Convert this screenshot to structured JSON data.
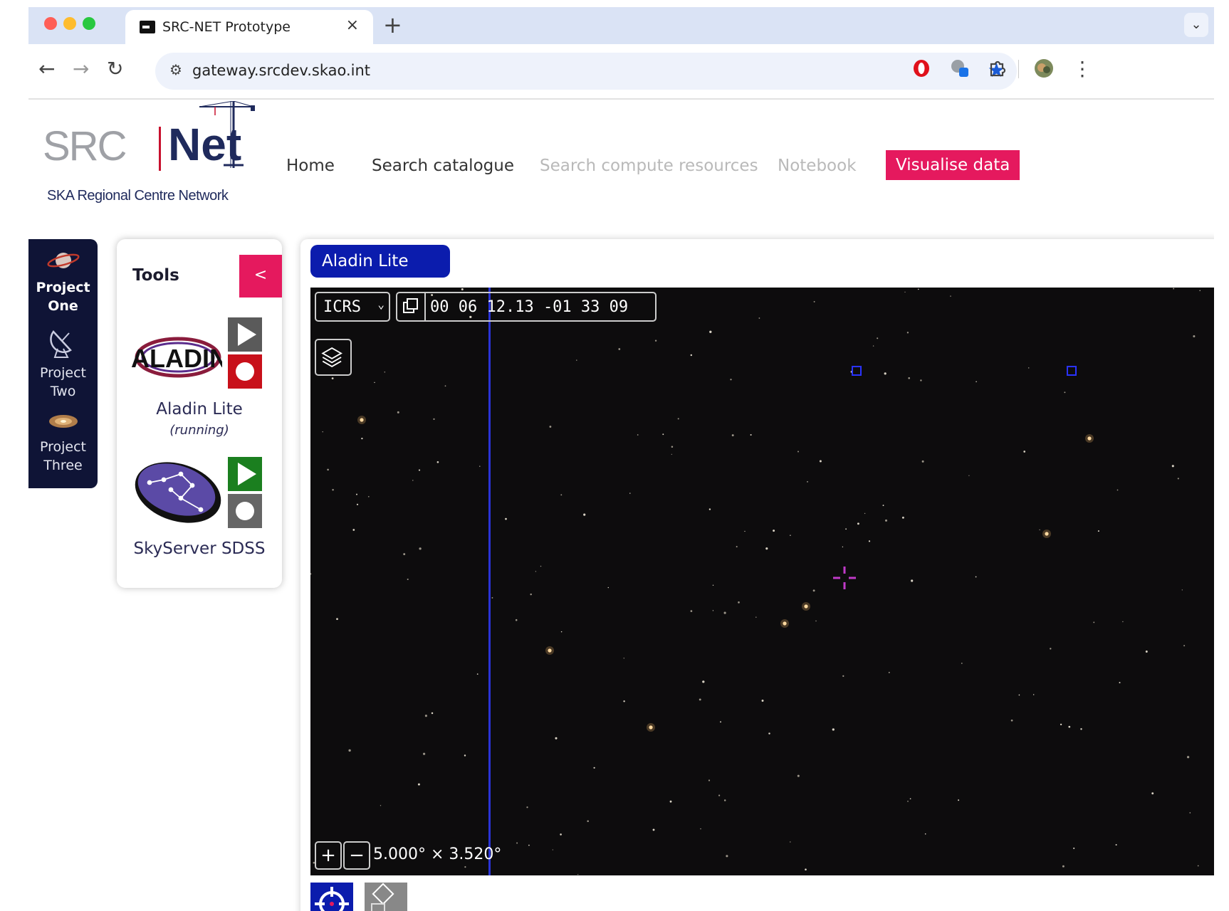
{
  "browser": {
    "tab_title": "SRC-NET Prototype",
    "tab_close": "×",
    "new_tab": "+",
    "tab_dropdown": "⌄",
    "url": "gateway.srcdev.skao.int",
    "back": "←",
    "forward": "→",
    "reload": "↻",
    "bookmark_star": "★",
    "site_settings": "⚙",
    "menu": "⋮",
    "colors": {
      "tabstrip": "#dae3f5",
      "star": "#1a5bd6"
    }
  },
  "site": {
    "logo_src": "SRC",
    "logo_net": "Net",
    "logo_tagline": "SKA Regional Centre Network",
    "nav": {
      "home": "Home",
      "search_catalogue": "Search catalogue",
      "search_compute": "Search compute resources",
      "notebook": "Notebook",
      "visualise": "Visualise data"
    },
    "accent_color": "#e5195e",
    "navy_color": "#0f1436"
  },
  "projects": [
    {
      "line1": "Project",
      "line2": "One",
      "icon": "saturn-icon"
    },
    {
      "line1": "Project",
      "line2": "Two",
      "icon": "satellite-dish-icon"
    },
    {
      "line1": "Project",
      "line2": "Three",
      "icon": "galaxy-icon"
    }
  ],
  "tools": {
    "title": "Tools",
    "collapse": "<",
    "items": [
      {
        "logo_text": "ALADIN",
        "name": "Aladin Lite",
        "status": "(running)",
        "icon": "aladin-logo"
      },
      {
        "name": "SkyServer SDSS",
        "icon": "skyserver-logo"
      }
    ]
  },
  "viewer": {
    "tab": "Aladin Lite",
    "frame": "ICRS",
    "coordinates": "00 06 12.13 -01 33 09",
    "zoom_in": "+",
    "zoom_out": "−",
    "fov": "5.000° × 3.520°",
    "colors": {
      "tab": "#0b1cad",
      "sky": "#0d0c0d",
      "reticle": "#c03ac8"
    }
  }
}
